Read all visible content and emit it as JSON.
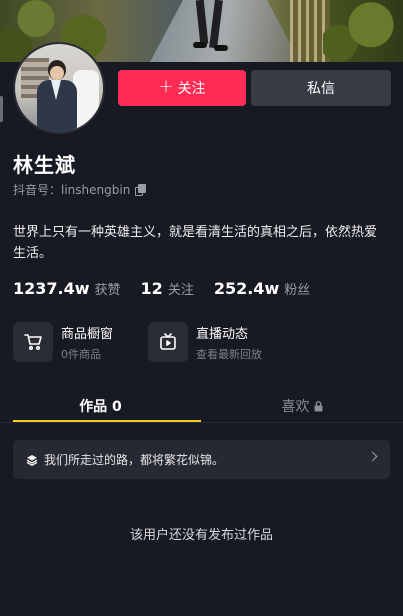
{
  "profile": {
    "name": "林生斌",
    "account_label": "抖音号：",
    "account_id": "linshengbin",
    "bio": "世界上只有一种英雄主义，就是看清生活的真相之后，依然热爱生活。"
  },
  "actions": {
    "follow_label": "关注",
    "follow_plus": "+",
    "message_label": "私信"
  },
  "stats": [
    {
      "value": "1237.4w",
      "label": "获赞"
    },
    {
      "value": "12",
      "label": "关注"
    },
    {
      "value": "252.4w",
      "label": "粉丝"
    }
  ],
  "features": {
    "shop": {
      "title": "商品橱窗",
      "subtitle": "0件商品",
      "icon": "cart-icon"
    },
    "live": {
      "title": "直播动态",
      "subtitle": "查看最新回放",
      "icon": "tv-play-icon"
    }
  },
  "tabs": {
    "works": "作品 0",
    "likes": "喜欢",
    "likes_icon": "lock-icon"
  },
  "notice": {
    "text": "我们所走过的路，都将繁花似锦。",
    "icon": "layers-icon"
  },
  "empty_state": "该用户还没有发布过作品",
  "colors": {
    "background": "#171923",
    "follow_button": "#fe2c55",
    "message_button": "#393b44",
    "tab_indicator": "#face15"
  }
}
